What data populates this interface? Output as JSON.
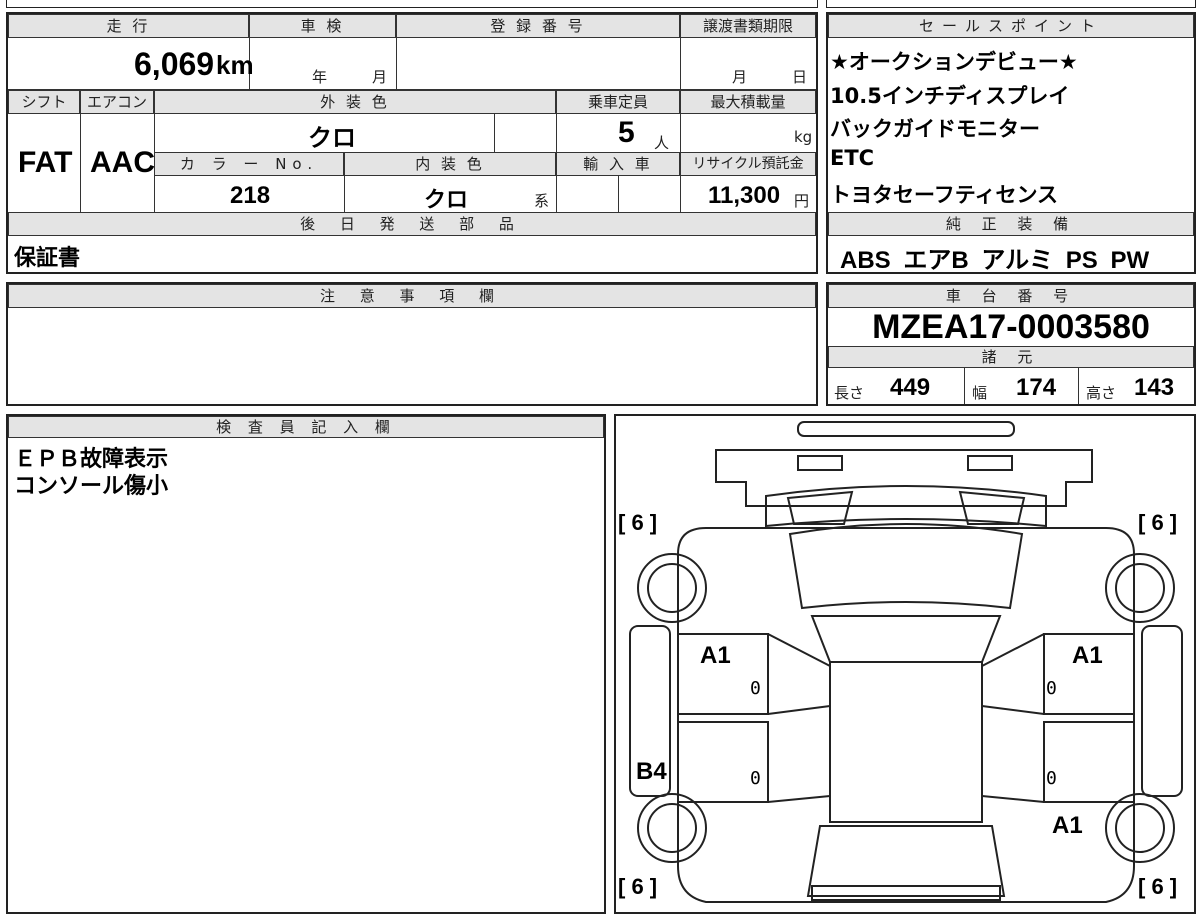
{
  "header": {
    "mileage_label": "走 行",
    "inspection_label": "車 検",
    "registration_label": "登 録 番 号",
    "transfer_deadline_label": "譲渡書類期限",
    "sales_points_label": "セールスポイント"
  },
  "mileage": {
    "value": "6,069",
    "unit": "km"
  },
  "inspection": {
    "year_label": "年",
    "month_label": "月"
  },
  "transfer_deadline": {
    "month_label": "月",
    "day_label": "日"
  },
  "row2": {
    "shift_label": "シフト",
    "aircon_label": "エアコン",
    "exterior_color_label": "外 装 色",
    "capacity_label": "乗車定員",
    "max_load_label": "最大積載量",
    "shift_value": "FAT",
    "aircon_value": "AAC",
    "exterior_color_value": "クロ",
    "capacity_value": "5",
    "capacity_unit": "人",
    "max_load_unit": "kg"
  },
  "row3": {
    "color_no_label": "カ ラ ー No.",
    "interior_color_label": "内 装 色",
    "import_label": "輸 入 車",
    "recycle_label": "リサイクル預託金",
    "color_no_value": "218",
    "interior_color_value": "クロ",
    "interior_suffix": "系",
    "recycle_value": "11,300",
    "recycle_unit": "円"
  },
  "later_parts": {
    "label": "後 日 発 送 部 品",
    "value": "保証書"
  },
  "sales_points": [
    "★オークションデビュー★",
    "10.5インチディスプレイ",
    "バックガイドモニター",
    "ETC",
    "トヨタセーフティセンス"
  ],
  "genuine_equipment": {
    "label": "純 正 装 備",
    "value": "ABS エアB アルミ PS PW"
  },
  "notes": {
    "label": "注 意 事 項 欄"
  },
  "chassis": {
    "label": "車 台 番 号",
    "value": "MZEA17-0003580"
  },
  "specs": {
    "label": "諸 元",
    "length_label": "長さ",
    "length_value": "449",
    "width_label": "幅",
    "width_value": "174",
    "height_label": "高さ",
    "height_value": "143"
  },
  "inspector": {
    "label": "検 査 員 記 入 欄",
    "lines": [
      "ＥＰＢ故障表示",
      "コンソール傷小"
    ]
  },
  "diagram": {
    "tire_tl": "[ 6 ]",
    "tire_tr": "[ 6 ]",
    "tire_bl": "[ 6 ]",
    "tire_br": "[ 6 ]",
    "mark_front_left_door": "A1",
    "mark_front_right_door": "A1",
    "mark_left_rocker": "B4",
    "mark_right_rear_fender": "A1",
    "zero_fl": "0",
    "zero_fr": "0",
    "zero_rl": "0",
    "zero_rr": "0"
  }
}
